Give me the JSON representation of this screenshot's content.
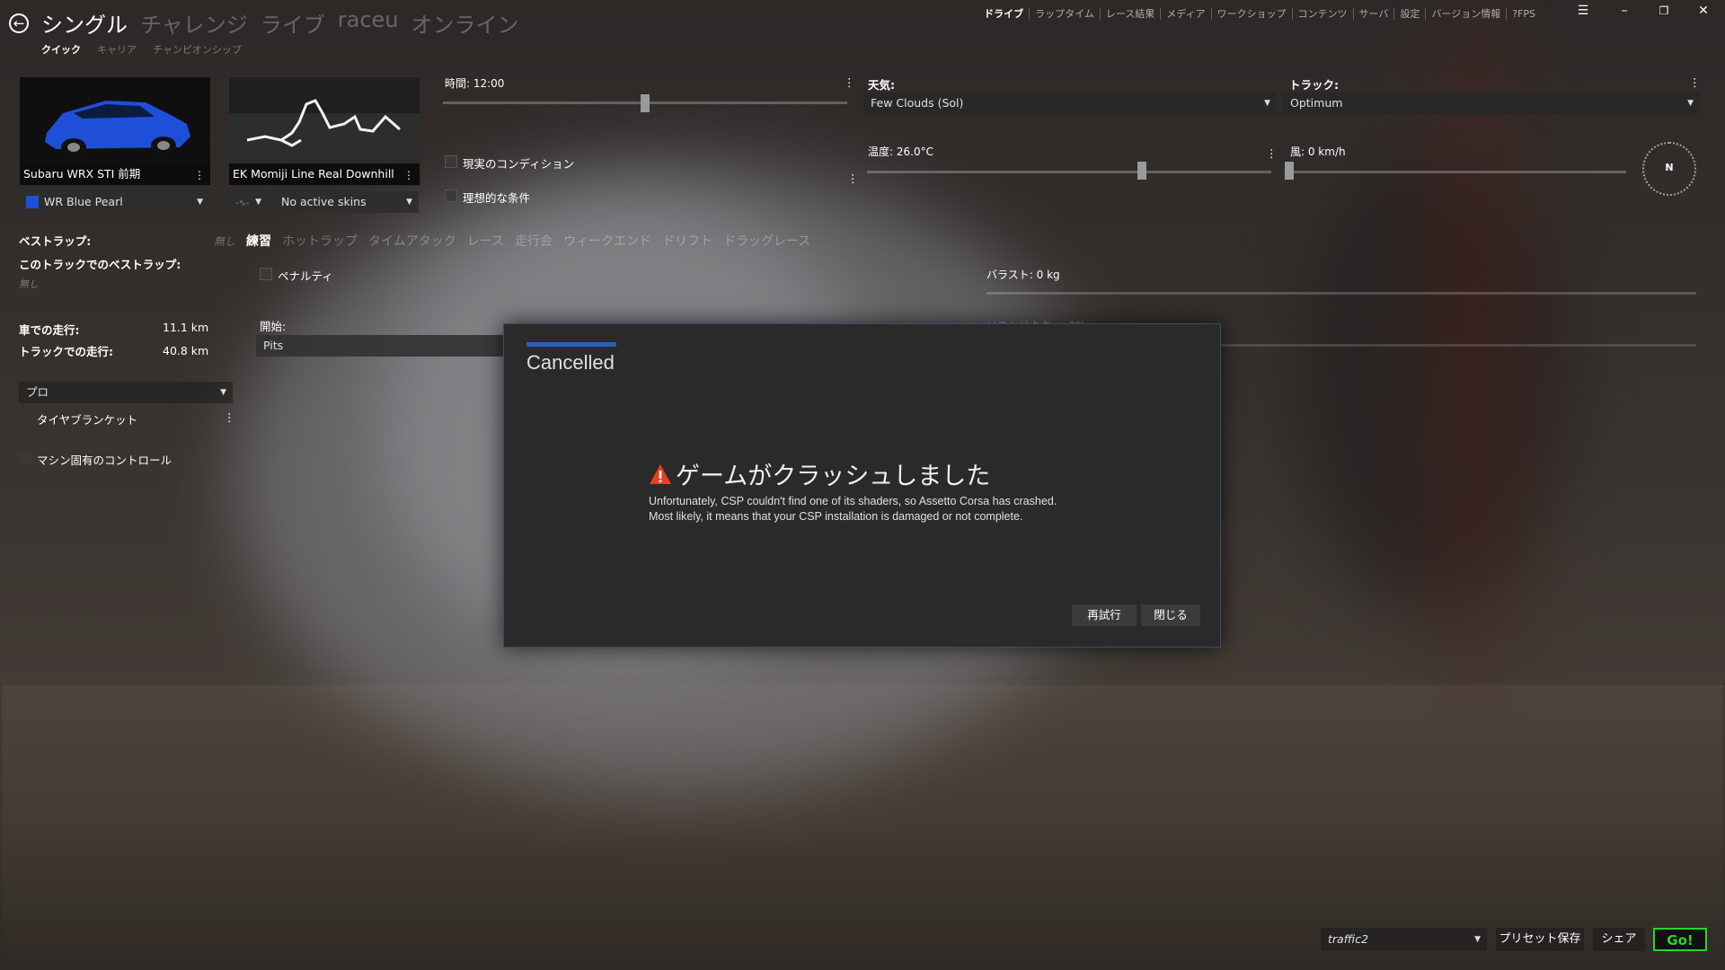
{
  "window": {
    "main_tabs": [
      "シングル",
      "チャレンジ",
      "ライブ",
      "raceu",
      "オンライン"
    ],
    "sub_tabs": [
      "クイック",
      "キャリア",
      "チャンピオンシップ"
    ],
    "top_nav": [
      "ドライブ",
      "ラップタイム",
      "レース結果",
      "メディア",
      "ワークショップ",
      "コンテンツ",
      "サーバ",
      "設定",
      "バージョン情報",
      "?FPS"
    ],
    "controls": {
      "menu": "☰",
      "minimize": "–",
      "restore": "❐",
      "close": "✕"
    }
  },
  "car": {
    "name": "Subaru WRX STI 前期",
    "skin": "WR Blue Pearl",
    "skin_color": "#1f4fd8"
  },
  "track": {
    "name": "EK Momiji Line Real Downhill",
    "layout_select": "-∿-",
    "skin": "No active skins"
  },
  "stats": {
    "best_lap_label": "ベストラップ:",
    "best_lap_track_label": "このトラックでのベストラップ:",
    "best_lap_value": "無し",
    "car_distance_label": "車での走行:",
    "car_distance_value": "11.1 km",
    "track_distance_label": "トラックでの走行:",
    "track_distance_value": "40.8 km"
  },
  "assists": {
    "preset": "プロ",
    "tyre_blankets": "タイヤブランケット",
    "car_specific": "マシン固有のコントロール"
  },
  "mode_tabs": [
    "無し",
    "練習",
    "ホットラップ",
    "タイムアタック",
    "レース",
    "走行会",
    "ウィークエンド",
    "ドリフト",
    "ドラッグレース"
  ],
  "mode_active": "練習",
  "session": {
    "penalty_label": "ペナルティ",
    "start_label": "開始:",
    "start_value": "Pits",
    "ballast_label": "バラスト: 0 kg",
    "restrictor_label": "リストリクター: 0%"
  },
  "conditions": {
    "time_label": "時間: 12:00",
    "real_conditions": "現実のコンディション",
    "ideal_conditions": "理想的な条件",
    "weather_label": "天気:",
    "weather_value": "Few Clouds (Sol)",
    "track_label": "トラック:",
    "track_value": "Optimum",
    "temp_label": "温度: 26.0°C",
    "wind_label": "風: 0 km/h",
    "compass_label": "N",
    "time_fraction": 0.5,
    "temp_fraction": 0.68
  },
  "dialog": {
    "title": "Cancelled",
    "headline": "ゲームがクラッシュしました",
    "line1": "Unfortunately, CSP couldn't find one of its shaders, so Assetto Corsa has crashed.",
    "line2": "Most likely, it means that your CSP installation is damaged or not complete.",
    "retry": "再試行",
    "close": "閉じる",
    "warning_color": "#e8401c"
  },
  "bottom": {
    "preset_value": "traffic2",
    "save_preset": "プリセット保存",
    "share": "シェア",
    "go": "Go!"
  },
  "more_glyph": "⋮",
  "caret_glyph": "▼"
}
